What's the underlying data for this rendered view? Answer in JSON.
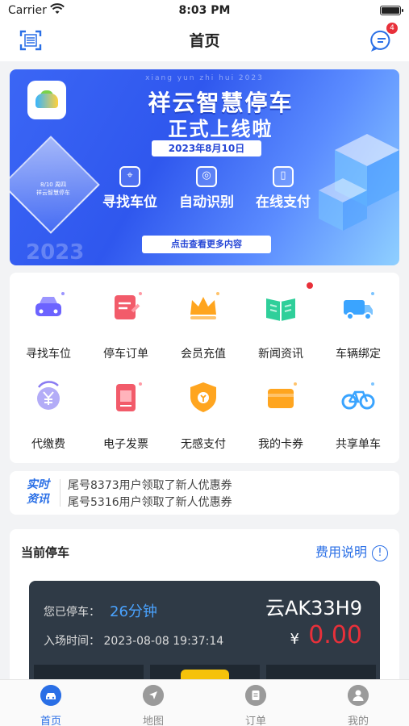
{
  "status": {
    "carrier": "Carrier",
    "time": "8:03 PM"
  },
  "header": {
    "title": "首页",
    "message_badge": "4"
  },
  "banner": {
    "tagline_en": "xiang yun zhi hui 2023",
    "headline": "祥云智慧停车",
    "subheadline": "正式上线啦",
    "date": "2023年8月10日",
    "features": [
      "寻找车位",
      "自动识别",
      "在线支付"
    ],
    "more_button": "点击查看更多内容",
    "diamond_caption_1": "8/10 周四",
    "diamond_caption_2": "祥云智慧停车",
    "year": "2023"
  },
  "grid": {
    "items": [
      {
        "label": "寻找车位",
        "icon": "car-icon",
        "color": "#6c63ff"
      },
      {
        "label": "停车订单",
        "icon": "order-icon",
        "color": "#f25b6a"
      },
      {
        "label": "会员充值",
        "icon": "crown-icon",
        "color": "#ffa51f"
      },
      {
        "label": "新闻资讯",
        "icon": "book-icon",
        "color": "#2fcf9a"
      },
      {
        "label": "车辆绑定",
        "icon": "truck-icon",
        "color": "#3aa4ff"
      },
      {
        "label": "代缴费",
        "icon": "yuan-coin-icon",
        "color": "#8a7bf2"
      },
      {
        "label": "电子发票",
        "icon": "invoice-icon",
        "color": "#f25b6a"
      },
      {
        "label": "无感支付",
        "icon": "shield-money-icon",
        "color": "#ffa51f"
      },
      {
        "label": "我的卡券",
        "icon": "wallet-icon",
        "color": "#ffa51f"
      },
      {
        "label": "共享单车",
        "icon": "bicycle-icon",
        "color": "#3aa4ff"
      }
    ]
  },
  "news": {
    "tag_line1": "实时",
    "tag_line2": "资讯",
    "lines": [
      "尾号8373用户领取了新人优惠券",
      "尾号5316用户领取了新人优惠券"
    ]
  },
  "parking": {
    "title": "当前停车",
    "fee_link": "费用说明",
    "parked_label": "您已停车：",
    "duration": "26分钟",
    "plate": "云AK33H9",
    "entry_label": "入场时间：",
    "entry_time": "2023-08-08 19:37:14",
    "currency": "¥",
    "amount": "0.00"
  },
  "tabbar": {
    "tabs": [
      {
        "label": "首页",
        "icon": "car-home-icon",
        "active": true
      },
      {
        "label": "地图",
        "icon": "compass-icon",
        "active": false
      },
      {
        "label": "订单",
        "icon": "order-list-icon",
        "active": false
      },
      {
        "label": "我的",
        "icon": "user-icon",
        "active": false
      }
    ]
  },
  "colors": {
    "accent": "#2a6fe6",
    "alert": "#e8303a",
    "card_bg": "#2f3a46"
  }
}
